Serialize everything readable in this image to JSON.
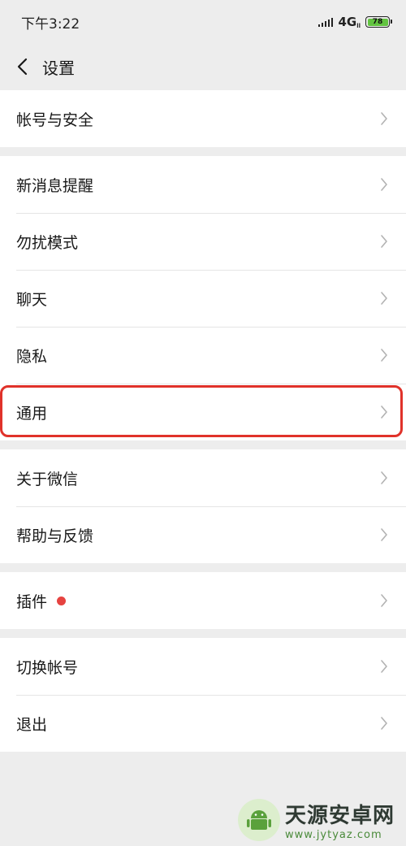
{
  "status_bar": {
    "time": "下午3:22",
    "network": "4G",
    "network_sub": "ll",
    "battery": "78"
  },
  "nav": {
    "title": "设置"
  },
  "groups": [
    {
      "items": [
        {
          "label": "帐号与安全"
        }
      ]
    },
    {
      "items": [
        {
          "label": "新消息提醒"
        },
        {
          "label": "勿扰模式"
        },
        {
          "label": "聊天"
        },
        {
          "label": "隐私"
        },
        {
          "label": "通用"
        }
      ]
    },
    {
      "items": [
        {
          "label": "关于微信"
        },
        {
          "label": "帮助与反馈"
        }
      ]
    },
    {
      "items": [
        {
          "label": "插件",
          "badge": "red-dot"
        }
      ]
    },
    {
      "items": [
        {
          "label": "切换帐号"
        },
        {
          "label": "退出"
        }
      ]
    }
  ],
  "highlight_color": "#e0322a",
  "watermark": {
    "title": "天源安卓网",
    "url": "www.jytyaz.com"
  }
}
